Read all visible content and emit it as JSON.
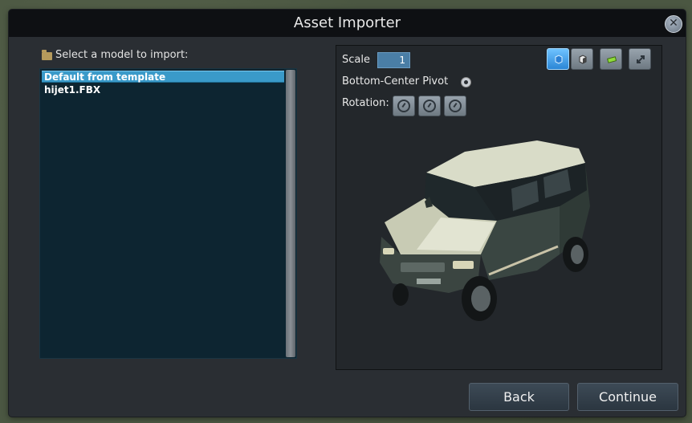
{
  "window": {
    "title": "Asset Importer"
  },
  "left_panel": {
    "select_label": "Select a model to import:",
    "models": [
      {
        "label": "Default from template",
        "selected": true
      },
      {
        "label": "hijet1.FBX",
        "selected": false
      }
    ]
  },
  "preview": {
    "scale_label": "Scale",
    "scale_value": "1",
    "pivot_label": "Bottom-Center Pivot",
    "rotation_label": "Rotation:",
    "view_buttons": [
      "cube-view-icon",
      "shaded-view-icon",
      "texture-view-icon",
      "expand-icon"
    ],
    "rotation_buttons": [
      "rotate-x-icon",
      "rotate-y-icon",
      "rotate-z-icon"
    ]
  },
  "footer": {
    "back_label": "Back",
    "continue_label": "Continue"
  },
  "colors": {
    "title_bg": "#0e1013",
    "window_bg": "#2a2e33",
    "list_bg": "#0d2531",
    "selection": "#3a9ac9",
    "accent": "#4a7ea6"
  }
}
